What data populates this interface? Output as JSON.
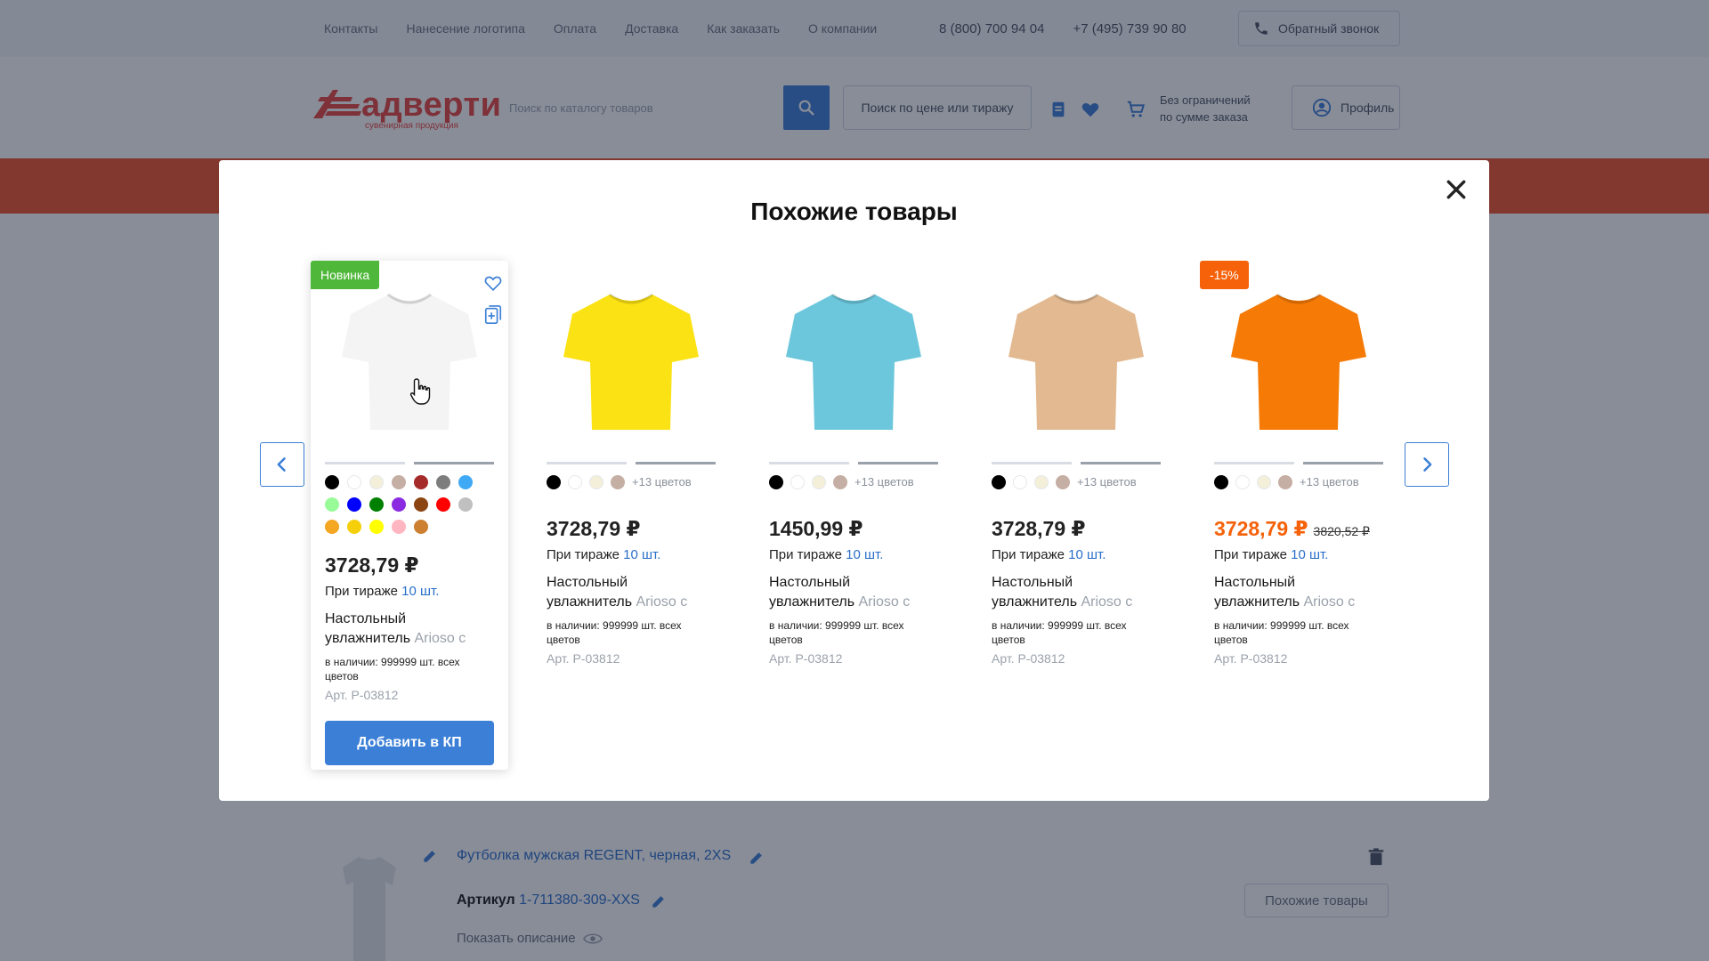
{
  "topbar": {
    "nav": [
      "Контакты",
      "Нанесение логотипа",
      "Оплата",
      "Доставка",
      "Как заказать",
      "О компании"
    ],
    "phone1": "8 (800) 700 94 04",
    "phone2": "+7 (495) 739 90 80",
    "callback_label": "Обратный звонок"
  },
  "header": {
    "logo_text": "адверти",
    "logo_tagline": "сувенирная продукция",
    "search_placeholder": "Поиск по каталогу товаров",
    "price_search_label": "Поиск по цене или тиражу",
    "cart_line1": "Без ограничений",
    "cart_line2": "по сумме заказа",
    "profile_label": "Профиль"
  },
  "background_item": {
    "title": "Футболка мужская REGENT, черная, 2XS",
    "article_label": "Артикул",
    "article_value": "1-711380-309-XXS",
    "show_desc": "Показать описание",
    "similar_button": "Похожие товары"
  },
  "modal": {
    "title": "Похожие товары",
    "add_button": "Добавить в КП",
    "cards": [
      {
        "badge": "Новинка",
        "price": "3728,79 ₽",
        "tirazh_label": "При тираже",
        "tirazh_qty": "10 шт.",
        "name1": "Настольный",
        "name2a": "увлажнитель",
        "name2b": " Arioso с",
        "stock": "в наличии: 999999 шт. всех цветов",
        "art": "Арт. P-03812",
        "shirt_color": "#f4f4f4",
        "swatches": [
          "#000000",
          "#ffffff",
          "#f3efd9",
          "#c5aea3",
          "#a52a2a",
          "#7d7d7d",
          "#3fa9f5",
          "#98fb98",
          "#0000ff",
          "#008000",
          "#8a2be2",
          "#8b4513",
          "#ff0000",
          "#c0c0c0",
          "#f5a623",
          "#f5d00a",
          "#ffff00",
          "#ffb6c1",
          "#cd7f32"
        ]
      },
      {
        "price": "3728,79 ₽",
        "tirazh_label": "При тираже",
        "tirazh_qty": "10 шт.",
        "name1": "Настольный",
        "name2a": "увлажнитель",
        "name2b": " Arioso с",
        "stock": "в наличии: 999999 шт. всех цветов",
        "art": "Арт. P-03812",
        "shirt_color": "#fbe214",
        "swatches": [
          "#000000",
          "#ffffff",
          "#f3efd9",
          "#c5aea3"
        ],
        "more_colors": "+13 цветов"
      },
      {
        "price": "1450,99 ₽",
        "tirazh_label": "При тираже",
        "tirazh_qty": "10 шт.",
        "name1": "Настольный",
        "name2a": "увлажнитель",
        "name2b": " Arioso с",
        "stock": "в наличии: 999999 шт. всех цветов",
        "art": "Арт. P-03812",
        "shirt_color": "#6cc7dc",
        "swatches": [
          "#000000",
          "#ffffff",
          "#f3efd9",
          "#c5aea3"
        ],
        "more_colors": "+13 цветов"
      },
      {
        "price": "3728,79 ₽",
        "tirazh_label": "При тираже",
        "tirazh_qty": "10 шт.",
        "name1": "Настольный",
        "name2a": "увлажнитель",
        "name2b": " Arioso с",
        "stock": "в наличии: 999999 шт. всех цветов",
        "art": "Арт. P-03812",
        "shirt_color": "#e2b990",
        "swatches": [
          "#000000",
          "#ffffff",
          "#f3efd9",
          "#c5aea3"
        ],
        "more_colors": "+13 цветов"
      },
      {
        "badge": "-15%",
        "price": "3728,79 ₽",
        "old_price": "3820,52 ₽",
        "tirazh_label": "При тираже",
        "tirazh_qty": "10 шт.",
        "name1": "Настольный",
        "name2a": "увлажнитель",
        "name2b": " Arioso с",
        "stock": "в наличии: 999999 шт. всех цветов",
        "art": "Арт. P-03812",
        "shirt_color": "#f57a06",
        "swatches": [
          "#000000",
          "#ffffff",
          "#f3efd9",
          "#c5aea3"
        ],
        "more_colors": "+13 цветов"
      }
    ]
  },
  "colors": {
    "accent": "#3b7fd6",
    "brand": "#e8473e",
    "new_badge": "#4fb83a",
    "sale": "#f5620a"
  }
}
